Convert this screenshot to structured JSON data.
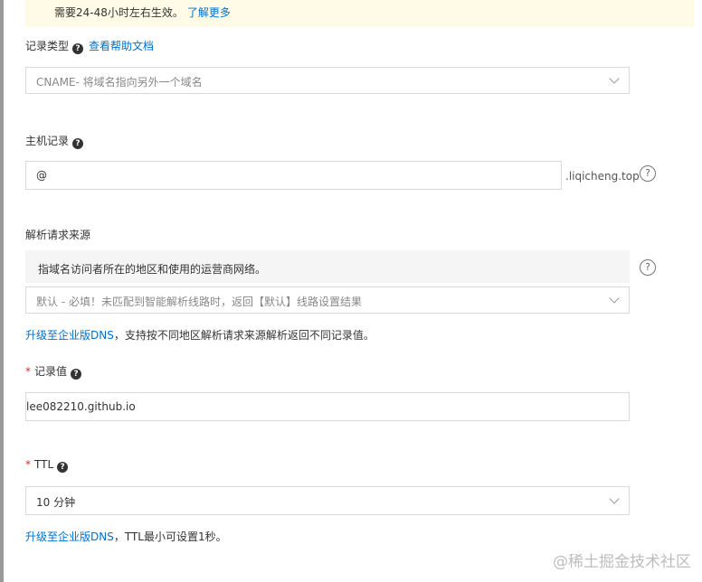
{
  "notice": {
    "text": "需要24-48小时左右生效。",
    "link": "了解更多"
  },
  "record_type": {
    "label": "记录类型",
    "help_link": "查看帮助文档",
    "placeholder": "CNAME- 将域名指向另外一个域名"
  },
  "host": {
    "label": "主机记录",
    "value": "@",
    "suffix": ".liqicheng.top"
  },
  "source": {
    "label": "解析请求来源",
    "tip": "指域名访问者所在的地区和使用的运营商网络。",
    "placeholder": "默认 - 必填！未匹配到智能解析线路时，返回【默认】线路设置结果",
    "upgrade_link": "升级至企业版DNS",
    "upgrade_text": "，支持按不同地区解析请求来源解析返回不同记录值。"
  },
  "record_value": {
    "required_mark": "*",
    "label": "记录值",
    "value": "lee082210.github.io"
  },
  "ttl": {
    "required_mark": "*",
    "label": "TTL",
    "value": "10 分钟",
    "upgrade_link": "升级至企业版DNS",
    "upgrade_text": "，TTL最小可设置1秒。"
  },
  "icons": {
    "question": "?",
    "help": "question-circle-icon",
    "dropdown": "chevron-down-icon"
  },
  "watermark": "@稀土掘金技术社区"
}
